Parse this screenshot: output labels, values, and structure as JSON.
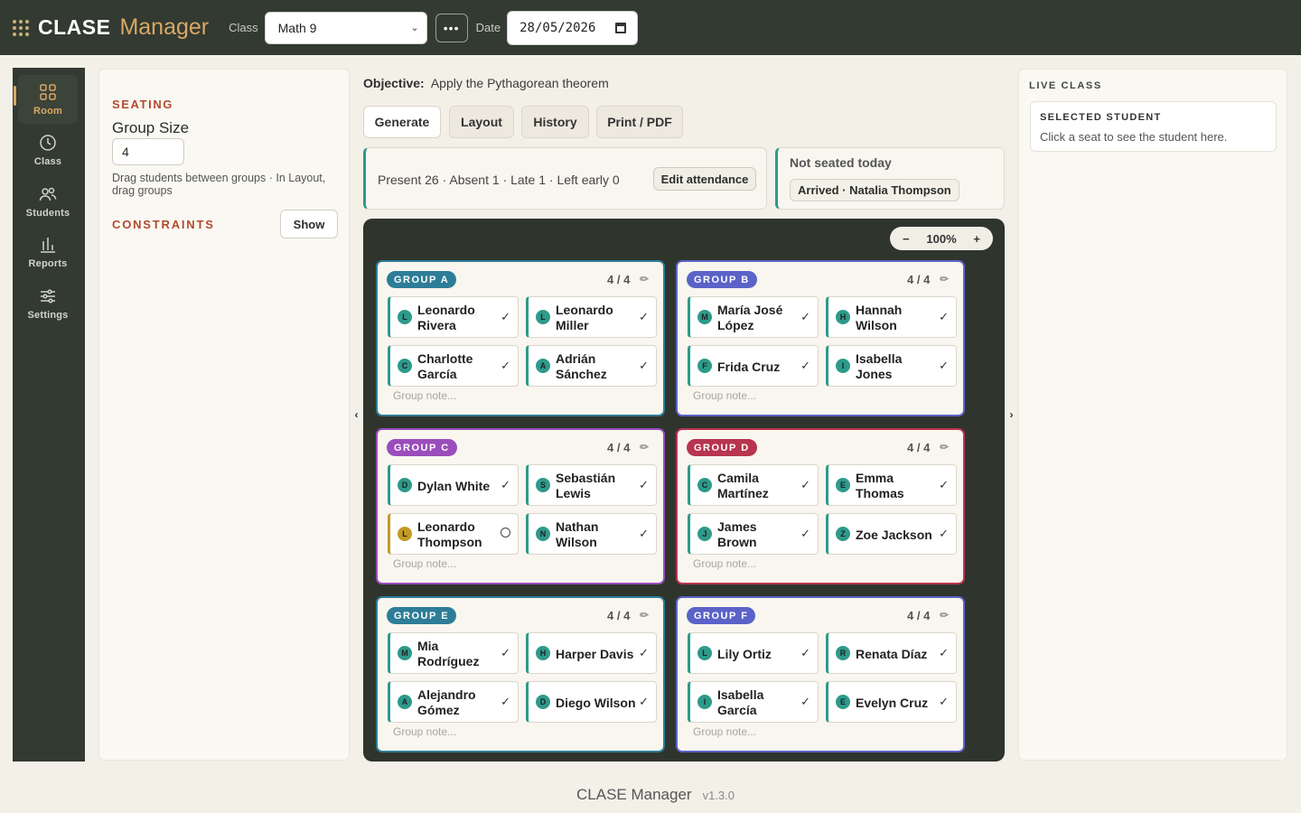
{
  "app": {
    "brand_main": "CLASE",
    "brand_sub": "Manager"
  },
  "topbar": {
    "class_label": "Class",
    "class_value": "Math 9",
    "date_label": "Date",
    "date_value": "28/05/2026"
  },
  "rail": [
    {
      "label": "Room",
      "icon": "grid-icon",
      "active": true
    },
    {
      "label": "Class",
      "icon": "clock-icon"
    },
    {
      "label": "Students",
      "icon": "users-icon"
    },
    {
      "label": "Reports",
      "icon": "bar-chart-icon"
    },
    {
      "label": "Settings",
      "icon": "sliders-icon"
    }
  ],
  "seating": {
    "title": "SEATING",
    "group_size_label": "Group Size",
    "group_size_value": "4",
    "hint": "Drag students between groups · In Layout, drag groups",
    "constraints_title": "CONSTRAINTS",
    "show_label": "Show"
  },
  "objective": {
    "label": "Objective:",
    "text": "Apply the Pythagorean theorem"
  },
  "tabs": [
    "Generate",
    "Layout",
    "History",
    "Print / PDF"
  ],
  "attendance": {
    "summary": "Present 26 · Absent 1 · Late 1 · Left early 0",
    "edit_label": "Edit attendance"
  },
  "not_seated": {
    "title": "Not seated today",
    "chip": "Arrived · Natalia Thompson"
  },
  "zoom": {
    "minus": "−",
    "value": "100%",
    "plus": "+"
  },
  "groups": [
    {
      "name": "GROUP A",
      "count": "4 / 4",
      "color": "#2e7d98",
      "note": "Group note...",
      "students": [
        {
          "name": "Leonardo Rivera",
          "initial": "L"
        },
        {
          "name": "Leonardo Miller",
          "initial": "L"
        },
        {
          "name": "Charlotte García",
          "initial": "C"
        },
        {
          "name": "Adrián Sánchez",
          "initial": "A"
        }
      ]
    },
    {
      "name": "GROUP B",
      "count": "4 / 4",
      "color": "#5b63c8",
      "note": "Group note...",
      "students": [
        {
          "name": "María José López",
          "initial": "M"
        },
        {
          "name": "Hannah Wilson",
          "initial": "H"
        },
        {
          "name": "Frida Cruz",
          "initial": "F"
        },
        {
          "name": "Isabella Jones",
          "initial": "I"
        }
      ]
    },
    {
      "name": "GROUP C",
      "count": "4 / 4",
      "color": "#9a4dbb",
      "note": "Group note...",
      "students": [
        {
          "name": "Dylan White",
          "initial": "D"
        },
        {
          "name": "Sebastián Lewis",
          "initial": "S"
        },
        {
          "name": "Leonardo Thompson",
          "initial": "L",
          "late": true
        },
        {
          "name": "Nathan Wilson",
          "initial": "N"
        }
      ]
    },
    {
      "name": "GROUP D",
      "count": "4 / 4",
      "color": "#b8344f",
      "note": "Group note...",
      "students": [
        {
          "name": "Camila Martínez",
          "initial": "C"
        },
        {
          "name": "Emma Thomas",
          "initial": "E"
        },
        {
          "name": "James Brown",
          "initial": "J"
        },
        {
          "name": "Zoe Jackson",
          "initial": "Z"
        }
      ]
    },
    {
      "name": "GROUP E",
      "count": "4 / 4",
      "color": "#2e7d98",
      "note": "Group note...",
      "students": [
        {
          "name": "Mia Rodríguez",
          "initial": "M"
        },
        {
          "name": "Harper Davis",
          "initial": "H"
        },
        {
          "name": "Alejandro Gómez",
          "initial": "A"
        },
        {
          "name": "Diego Wilson",
          "initial": "D"
        }
      ]
    },
    {
      "name": "GROUP F",
      "count": "4 / 4",
      "color": "#5b63c8",
      "note": "Group note...",
      "students": [
        {
          "name": "Lily Ortiz",
          "initial": "L"
        },
        {
          "name": "Renata Díaz",
          "initial": "R"
        },
        {
          "name": "Isabella García",
          "initial": "I"
        },
        {
          "name": "Evelyn Cruz",
          "initial": "E"
        }
      ]
    }
  ],
  "live": {
    "title": "LIVE CLASS",
    "selected_title": "SELECTED STUDENT",
    "selected_text": "Click a seat to see the student here."
  },
  "footer": {
    "name": "CLASE Manager",
    "version": "v1.3.0"
  }
}
